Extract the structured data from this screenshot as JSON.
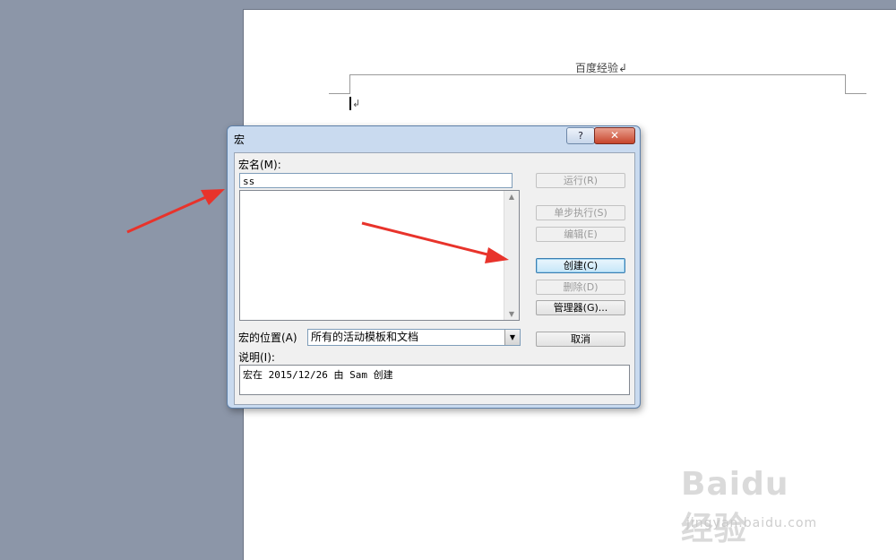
{
  "document": {
    "header_text": "百度经验",
    "para_mark": "↲"
  },
  "dialog": {
    "title": "宏",
    "help_label": "?",
    "close_label": "✕",
    "macro_name_label": "宏名(M):",
    "macro_name_value": "ss",
    "buttons": {
      "run": "运行(R)",
      "step": "单步执行(S)",
      "edit": "编辑(E)",
      "create": "创建(C)",
      "delete": "删除(D)",
      "organizer": "管理器(G)...",
      "cancel": "取消"
    },
    "location_label": "宏的位置(A)",
    "location_value": "所有的活动模板和文档",
    "description_label": "说明(I):",
    "description_value": "宏在 2015/12/26 由 Sam 创建"
  },
  "watermark": {
    "brand": "Baidu经验",
    "url": "jingyan.baidu.com"
  },
  "colors": {
    "annotation_arrow": "#e8332b",
    "dialog_frame": "#c9daef",
    "workspace": "#8c96a8"
  }
}
